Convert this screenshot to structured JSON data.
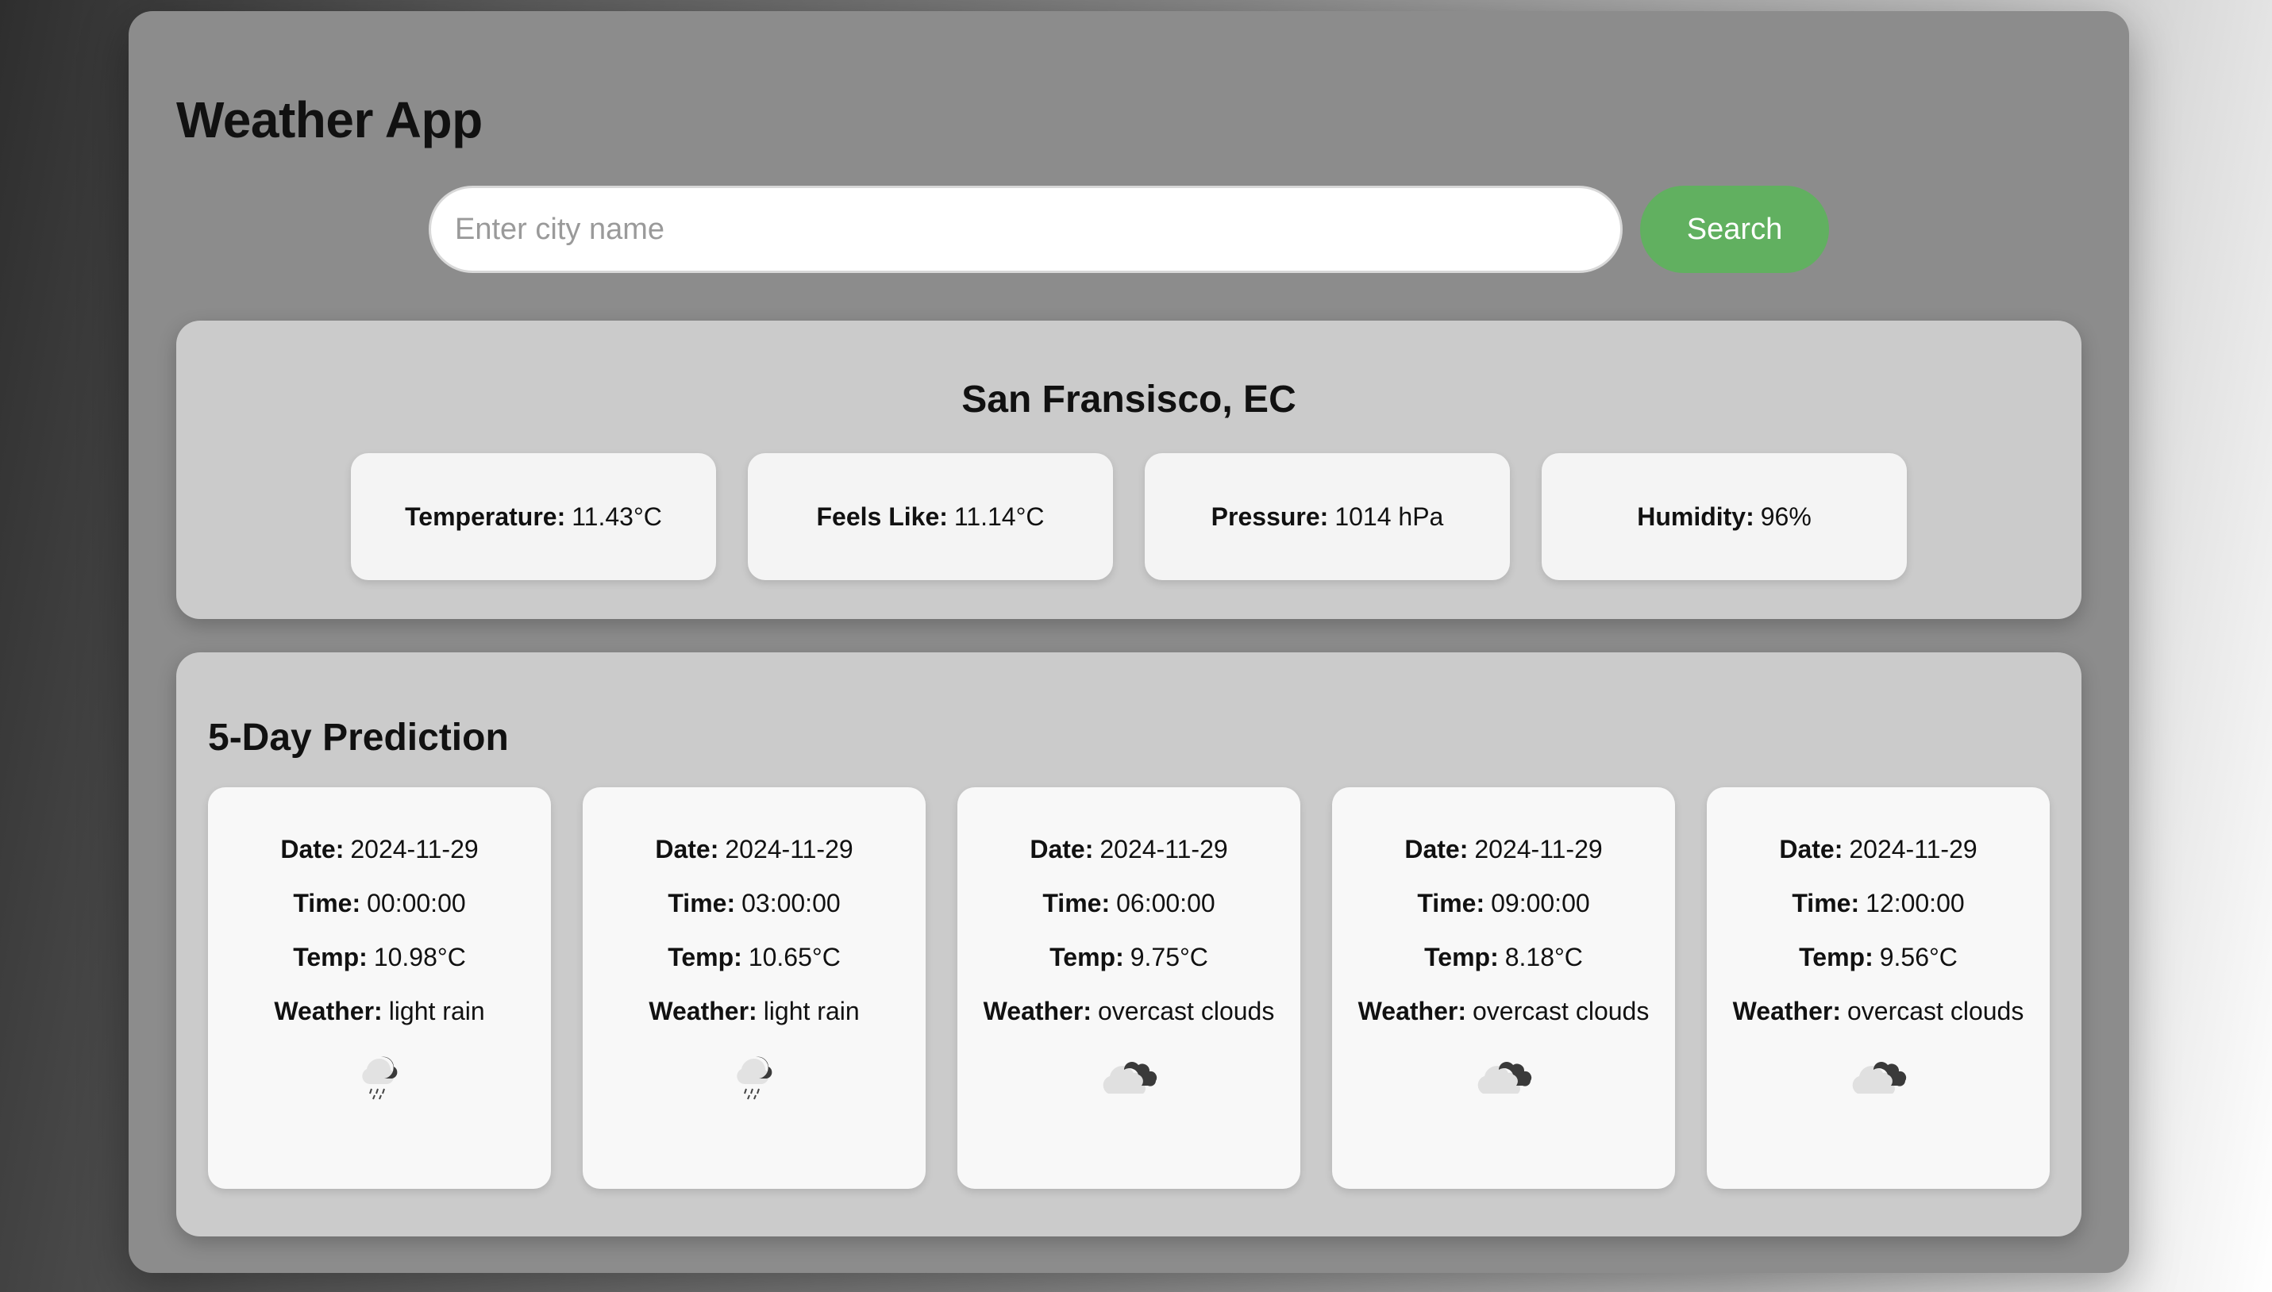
{
  "app": {
    "title": "Weather App"
  },
  "search": {
    "placeholder": "Enter city name",
    "value": "",
    "button_label": "Search",
    "button_color": "#61b060"
  },
  "current": {
    "city": "San Fransisco, EC",
    "stats": [
      {
        "label": "Temperature:",
        "value": "11.43°C"
      },
      {
        "label": "Feels Like:",
        "value": "11.14°C"
      },
      {
        "label": "Pressure:",
        "value": "1014 hPa"
      },
      {
        "label": "Humidity:",
        "value": "96%"
      }
    ]
  },
  "forecast": {
    "title": "5-Day Prediction",
    "labels": {
      "date": "Date:",
      "time": "Time:",
      "temp": "Temp:",
      "weather": "Weather:"
    },
    "items": [
      {
        "date": "2024-11-29",
        "time": "00:00:00",
        "temp": "10.98°C",
        "weather": "light rain",
        "icon": "rain-icon"
      },
      {
        "date": "2024-11-29",
        "time": "03:00:00",
        "temp": "10.65°C",
        "weather": "light rain",
        "icon": "rain-icon"
      },
      {
        "date": "2024-11-29",
        "time": "06:00:00",
        "temp": "9.75°C",
        "weather": "overcast clouds",
        "icon": "overcast-clouds-icon"
      },
      {
        "date": "2024-11-29",
        "time": "09:00:00",
        "temp": "8.18°C",
        "weather": "overcast clouds",
        "icon": "overcast-clouds-icon"
      },
      {
        "date": "2024-11-29",
        "time": "12:00:00",
        "temp": "9.56°C",
        "weather": "overcast clouds",
        "icon": "overcast-clouds-icon"
      }
    ]
  }
}
